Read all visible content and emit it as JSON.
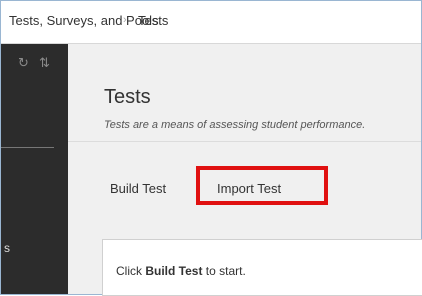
{
  "breadcrumb": {
    "parent": "Tests, Surveys, and Pools",
    "separator": "›",
    "current": "Tests"
  },
  "sidebar": {
    "icons": [
      "refresh-icon",
      "sort-icon"
    ],
    "refresh_glyph": "↻",
    "sort_glyph": "⇅",
    "partial_label": "s"
  },
  "page": {
    "title": "Tests",
    "subtitle": "Tests are a means of assessing student performance."
  },
  "tabs": [
    {
      "label": "Build Test"
    },
    {
      "label": "Import Test",
      "highlighted": true
    }
  ],
  "highlight_color": "#e01010",
  "panel": {
    "text_before": "Click ",
    "text_bold": "Build Test",
    "text_after": " to start."
  }
}
